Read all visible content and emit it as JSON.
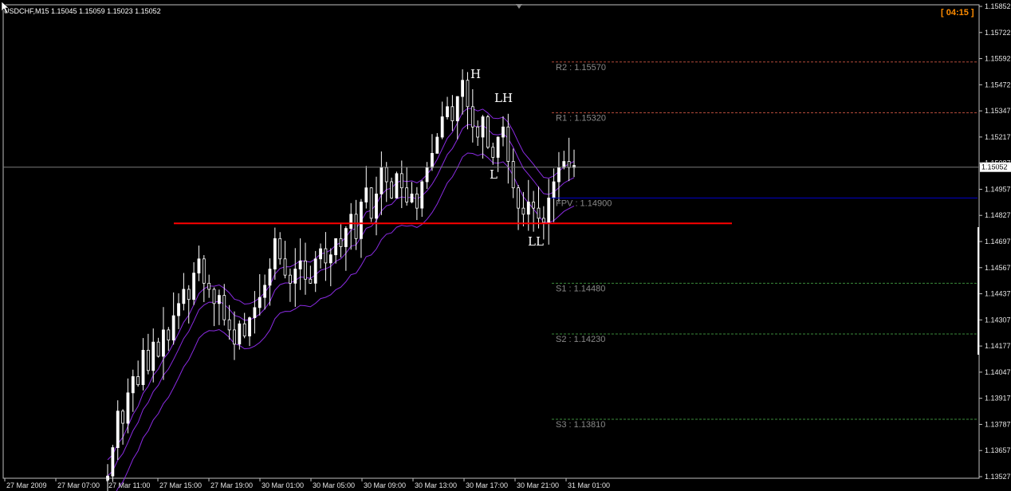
{
  "header": {
    "symbol_line": "USDCHF,M15  1.15045 1.15059 1.15023 1.15052",
    "timer": "[ 04:15 ]"
  },
  "colors": {
    "background": "#000000",
    "bull": "#ffffff",
    "ema": "#8a2be2",
    "support_line": "#ff0000",
    "pivot_line": "#0000cc",
    "resistance_dash": "#b44a3a",
    "support_dash": "#3a8a3a",
    "price_line": "#7a7a7a"
  },
  "chart_data": {
    "type": "candlestick",
    "y_ticks": [
      "1.15852",
      "1.15722",
      "1.15592",
      "1.15472",
      "1.15347",
      "1.15217",
      "1.15087",
      "1.14957",
      "1.14827",
      "1.14697",
      "1.14567",
      "1.14437",
      "1.14307",
      "1.14177",
      "1.14047",
      "1.13917",
      "1.13787",
      "1.13657",
      "1.13527"
    ],
    "ylim": [
      1.13527,
      1.15852
    ],
    "x_ticks": [
      "27 Mar 2009",
      "27 Mar 07:00",
      "27 Mar 11:00",
      "27 Mar 15:00",
      "27 Mar 19:00",
      "30 Mar 01:00",
      "30 Mar 05:00",
      "30 Mar 09:00",
      "30 Mar 13:00",
      "30 Mar 17:00",
      "30 Mar 21:00",
      "31 Mar 01:00"
    ],
    "current_price": "1.15052",
    "levels": [
      {
        "name": "R2",
        "label": "R2 : 1.15570",
        "value": 1.1557,
        "kind": "resistance"
      },
      {
        "name": "R1",
        "label": "R1 : 1.15320",
        "value": 1.1532,
        "kind": "resistance"
      },
      {
        "name": "FPV",
        "label": "FPV : 1.14900",
        "value": 1.149,
        "kind": "pivot"
      },
      {
        "name": "S1",
        "label": "S1 : 1.14480",
        "value": 1.1448,
        "kind": "support"
      },
      {
        "name": "S2",
        "label": "S2 : 1.14230",
        "value": 1.1423,
        "kind": "support"
      },
      {
        "name": "S3",
        "label": "S3 : 1.13810",
        "value": 1.1381,
        "kind": "support"
      }
    ],
    "support_line_value": 1.14775,
    "pattern_labels": [
      "H",
      "LH",
      "L",
      "LL"
    ],
    "candles_close": [
      1.1353,
      1.1367,
      1.1385,
      1.1379,
      1.1394,
      1.1402,
      1.1398,
      1.1415,
      1.1405,
      1.1419,
      1.1412,
      1.1425,
      1.142,
      1.1432,
      1.1438,
      1.1445,
      1.144,
      1.1453,
      1.146,
      1.1448,
      1.1445,
      1.1438,
      1.1442,
      1.143,
      1.1425,
      1.1418,
      1.1428,
      1.1422,
      1.1431,
      1.1436,
      1.1441,
      1.1447,
      1.1455,
      1.147,
      1.146,
      1.1452,
      1.1448,
      1.1455,
      1.1459,
      1.145,
      1.1448,
      1.146,
      1.1465,
      1.1458,
      1.1462,
      1.147,
      1.1466,
      1.1475,
      1.1482,
      1.147,
      1.1488,
      1.1495,
      1.148,
      1.1492,
      1.1505,
      1.1498,
      1.149,
      1.1502,
      1.1495,
      1.1488,
      1.1492,
      1.1485,
      1.1498,
      1.1505,
      1.1512,
      1.152,
      1.153,
      1.1535,
      1.1528,
      1.154,
      1.1548,
      1.1535,
      1.1525,
      1.152,
      1.153,
      1.1515,
      1.151,
      1.152,
      1.1525,
      1.1508,
      1.1495,
      1.1485,
      1.1482,
      1.1488,
      1.1485,
      1.148,
      1.1478,
      1.149,
      1.1498,
      1.1505,
      1.1508,
      1.1505,
      1.1506
    ]
  }
}
